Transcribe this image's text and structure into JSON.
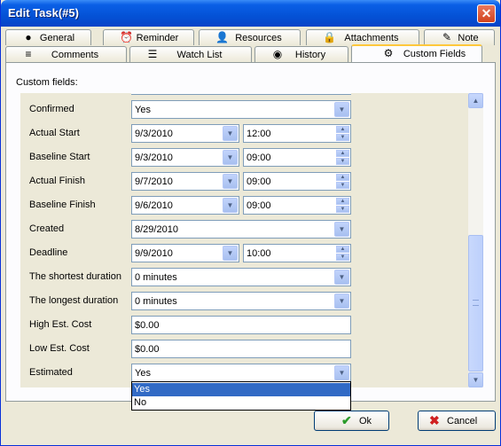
{
  "window": {
    "title": "Edit Task(#5)",
    "close_glyph": "✕"
  },
  "tabs_row1": [
    {
      "label": "General",
      "icon": "general-icon",
      "glyph": "●"
    },
    {
      "label": "Reminder",
      "icon": "alarm-clock-icon",
      "glyph": "⏰"
    },
    {
      "label": "Resources",
      "icon": "user-icon",
      "glyph": "👤"
    },
    {
      "label": "Attachments",
      "icon": "lock-icon",
      "glyph": "🔒"
    },
    {
      "label": "Note",
      "icon": "note-icon",
      "glyph": "✎"
    }
  ],
  "tabs_row2": [
    {
      "label": "Comments",
      "icon": "comments-icon",
      "glyph": "≡"
    },
    {
      "label": "Watch List",
      "icon": "watch-list-icon",
      "glyph": "☰"
    },
    {
      "label": "History",
      "icon": "history-icon",
      "glyph": "◉"
    },
    {
      "label": "Custom Fields",
      "icon": "gear-icon",
      "glyph": "⚙",
      "active": true
    }
  ],
  "panel": {
    "caption": "Custom fields:"
  },
  "fields": [
    {
      "label": "Confirmed",
      "value": "Yes",
      "type": "dropdown"
    },
    {
      "label": "Actual Start",
      "date": "9/3/2010",
      "time": "12:00",
      "type": "datetime"
    },
    {
      "label": "Baseline Start",
      "date": "9/3/2010",
      "time": "09:00",
      "type": "datetime"
    },
    {
      "label": "Actual Finish",
      "date": "9/7/2010",
      "time": "09:00",
      "type": "datetime"
    },
    {
      "label": "Baseline Finish",
      "date": "9/6/2010",
      "time": "09:00",
      "type": "datetime"
    },
    {
      "label": "Created",
      "value": "8/29/2010",
      "type": "dropdown"
    },
    {
      "label": "Deadline",
      "date": "9/9/2010",
      "time": "10:00",
      "type": "datetime"
    },
    {
      "label": "The shortest duration",
      "value": "0 minutes",
      "type": "dropdown"
    },
    {
      "label": "The longest duration",
      "value": "0 minutes",
      "type": "dropdown"
    },
    {
      "label": "High Est. Cost",
      "value": "$0.00",
      "type": "text"
    },
    {
      "label": "Low Est. Cost",
      "value": "$0.00",
      "type": "text"
    },
    {
      "label": "Estimated",
      "value": "Yes",
      "type": "dropdown"
    }
  ],
  "dropdown_open": {
    "options": [
      "Yes",
      "No"
    ],
    "selected": "Yes"
  },
  "buttons": {
    "ok": "Ok",
    "ok_glyph": "✔",
    "cancel": "Cancel",
    "cancel_glyph": "✖"
  },
  "colors": {
    "title_bar": "#0452d6",
    "selection": "#316ac5",
    "tab_highlight": "#ffc83c",
    "ok_check": "#2a9b2a",
    "cancel_x": "#d02020"
  }
}
